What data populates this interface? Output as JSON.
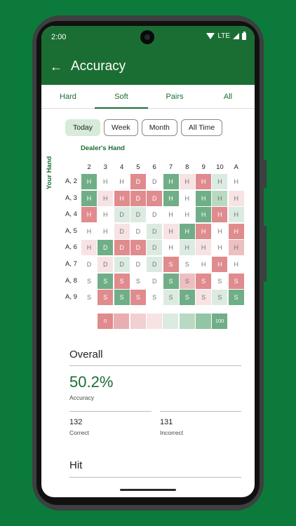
{
  "status": {
    "time": "2:00",
    "network": "LTE"
  },
  "appbar": {
    "title": "Accuracy"
  },
  "tabs": [
    {
      "label": "Hard",
      "active": false
    },
    {
      "label": "Soft",
      "active": true
    },
    {
      "label": "Pairs",
      "active": false
    },
    {
      "label": "All",
      "active": false
    }
  ],
  "filters": [
    {
      "label": "Today",
      "selected": true
    },
    {
      "label": "Week",
      "selected": false
    },
    {
      "label": "Month",
      "selected": false
    },
    {
      "label": "All Time",
      "selected": false
    }
  ],
  "grid": {
    "dealer_label": "Dealer's Hand",
    "hand_label": "Your Hand",
    "columns": [
      "2",
      "3",
      "4",
      "5",
      "6",
      "7",
      "8",
      "9",
      "10",
      "A"
    ],
    "rows": [
      {
        "label": "A, 2",
        "cells": [
          [
            "H",
            "g3"
          ],
          [
            "H",
            "n"
          ],
          [
            "H",
            "n"
          ],
          [
            "D",
            "r3"
          ],
          [
            "D",
            "n"
          ],
          [
            "H",
            "g3"
          ],
          [
            "H",
            "r1"
          ],
          [
            "H",
            "r3"
          ],
          [
            "H",
            "g1"
          ],
          [
            "H",
            "n"
          ]
        ]
      },
      {
        "label": "A, 3",
        "cells": [
          [
            "H",
            "g3"
          ],
          [
            "H",
            "r1"
          ],
          [
            "H",
            "r3"
          ],
          [
            "D",
            "r3"
          ],
          [
            "D",
            "r3"
          ],
          [
            "H",
            "g3"
          ],
          [
            "H",
            "n"
          ],
          [
            "H",
            "g3"
          ],
          [
            "H",
            "g2"
          ],
          [
            "H",
            "r1"
          ]
        ]
      },
      {
        "label": "A, 4",
        "cells": [
          [
            "H",
            "r3"
          ],
          [
            "H",
            "n"
          ],
          [
            "D",
            "g1"
          ],
          [
            "D",
            "g1"
          ],
          [
            "D",
            "n"
          ],
          [
            "H",
            "n"
          ],
          [
            "H",
            "n"
          ],
          [
            "H",
            "g3"
          ],
          [
            "H",
            "r3"
          ],
          [
            "H",
            "g1"
          ]
        ]
      },
      {
        "label": "A, 5",
        "cells": [
          [
            "H",
            "n"
          ],
          [
            "H",
            "n"
          ],
          [
            "D",
            "r1"
          ],
          [
            "D",
            "n"
          ],
          [
            "D",
            "g1"
          ],
          [
            "H",
            "r1"
          ],
          [
            "H",
            "g3"
          ],
          [
            "H",
            "r3"
          ],
          [
            "H",
            "n"
          ],
          [
            "H",
            "r3"
          ]
        ]
      },
      {
        "label": "A, 6",
        "cells": [
          [
            "H",
            "r1"
          ],
          [
            "D",
            "g3"
          ],
          [
            "D",
            "r3"
          ],
          [
            "D",
            "r3"
          ],
          [
            "D",
            "g1"
          ],
          [
            "H",
            "n"
          ],
          [
            "H",
            "g1"
          ],
          [
            "H",
            "r1"
          ],
          [
            "H",
            "n"
          ],
          [
            "H",
            "r2"
          ]
        ]
      },
      {
        "label": "A, 7",
        "cells": [
          [
            "D",
            "n"
          ],
          [
            "D",
            "r1"
          ],
          [
            "D",
            "g1"
          ],
          [
            "D",
            "n"
          ],
          [
            "D",
            "g1"
          ],
          [
            "S",
            "r3"
          ],
          [
            "S",
            "n"
          ],
          [
            "H",
            "n"
          ],
          [
            "H",
            "r3"
          ],
          [
            "H",
            "n"
          ]
        ]
      },
      {
        "label": "A, 8",
        "cells": [
          [
            "S",
            "n"
          ],
          [
            "S",
            "g3"
          ],
          [
            "S",
            "r3"
          ],
          [
            "S",
            "n"
          ],
          [
            "D",
            "n"
          ],
          [
            "S",
            "g3"
          ],
          [
            "S",
            "r2"
          ],
          [
            "S",
            "r3"
          ],
          [
            "S",
            "n"
          ],
          [
            "S",
            "r3"
          ]
        ]
      },
      {
        "label": "A, 9",
        "cells": [
          [
            "S",
            "n"
          ],
          [
            "S",
            "r3"
          ],
          [
            "S",
            "g3"
          ],
          [
            "S",
            "r3"
          ],
          [
            "S",
            "n"
          ],
          [
            "S",
            "g1"
          ],
          [
            "S",
            "g3"
          ],
          [
            "S",
            "r1"
          ],
          [
            "S",
            "g1"
          ],
          [
            "S",
            "g3"
          ]
        ]
      }
    ]
  },
  "legend": {
    "min_label": "0",
    "max_label": "100",
    "swatches": [
      "#e08b8e",
      "#e9aeb0",
      "#f2cfd0",
      "#f7e3e4",
      "#dcebe1",
      "#b9d9c3",
      "#93c5a4",
      "#6fae87"
    ]
  },
  "overall": {
    "title": "Overall",
    "accuracy_value": "50.2%",
    "accuracy_label": "Accuracy",
    "correct_value": "132",
    "correct_label": "Correct",
    "incorrect_value": "131",
    "incorrect_label": "Incorrect"
  },
  "hit": {
    "title": "Hit"
  },
  "colors": {
    "primary": "#1b6e33",
    "background": "#0c7a3a",
    "palette": {
      "n": "#ffffff",
      "r1": "#f7e3e4",
      "r2": "#eebfc1",
      "r3": "#e08b8e",
      "g1": "#dcebe1",
      "g2": "#b9d9c3",
      "g3": "#6fae87"
    }
  }
}
